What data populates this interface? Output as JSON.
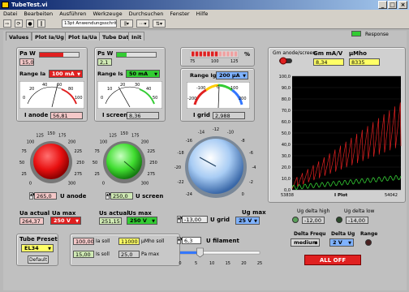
{
  "window": {
    "title": "TubeTest.vi"
  },
  "menu": [
    "Datei",
    "Bearbeiten",
    "Ausführen",
    "Werkzeuge",
    "Durchsuchen",
    "Fenster",
    "Hilfe"
  ],
  "toolbar": {
    "font": "13pt Anwendungsschriftart"
  },
  "tabs": [
    "Values",
    "Plot Ia/Ug",
    "Plot Ia/Ua",
    "Tube Data",
    "Init"
  ],
  "response_label": "Response",
  "pa": {
    "label": "Pa W",
    "value": "15,0",
    "range_label": "Range Ia",
    "range": "100 mA",
    "meter_ticks": [
      "0",
      "20",
      "40",
      "60",
      "80",
      "100"
    ],
    "caption": "I anode",
    "reading": "56,81",
    "level": 0.6
  },
  "ps": {
    "label": "Ps W",
    "value": "2,1",
    "range_label": "Range Is",
    "range": "50 mA",
    "meter_ticks": [
      "0",
      "10",
      "20",
      "30",
      "40",
      "50"
    ],
    "caption": "I screen",
    "reading": "8,36",
    "level": 0.25
  },
  "pct": {
    "unit": "%",
    "ticks": [
      "75",
      "100",
      "125"
    ]
  },
  "ig": {
    "range_label": "Range Ig",
    "range": "200 µA",
    "meter_ticks": [
      "-200",
      "-100",
      "0",
      "100",
      "200"
    ],
    "caption": "I grid",
    "reading": "2,988"
  },
  "knob_ua": {
    "ticks": [
      "0",
      "25",
      "50",
      "75",
      "100",
      "125",
      "150",
      "175",
      "200",
      "225",
      "250",
      "275",
      "300"
    ],
    "value": "265,0",
    "label": "U anode"
  },
  "knob_us": {
    "ticks": [
      "0",
      "25",
      "50",
      "75",
      "100",
      "125",
      "150",
      "175",
      "200",
      "225",
      "250",
      "275",
      "300"
    ],
    "value": "250,0",
    "label": "U screen"
  },
  "knob_ug": {
    "ticks": [
      "-24",
      "-22",
      "-20",
      "-18",
      "-16",
      "-14",
      "-12",
      "-10",
      "-8",
      "-6",
      "-4",
      "-2",
      "0"
    ],
    "value": "-13,00",
    "label": "U grid"
  },
  "ua_actual": {
    "label": "Ua actual",
    "value": "264,37"
  },
  "ua_max": {
    "label": "Ua max",
    "value": "250 V"
  },
  "us_actual": {
    "label": "Us actual",
    "value": "251,15"
  },
  "us_max": {
    "label": "Us max",
    "value": "250 V"
  },
  "ug_max": {
    "label": "Ug max",
    "value": "25 V"
  },
  "filament": {
    "value": "6,3",
    "label": "U filament",
    "ticks": [
      "0",
      "5",
      "10",
      "15",
      "20",
      "25"
    ],
    "level": 0.25
  },
  "preset": {
    "label": "Tube Preset",
    "value": "EL34",
    "default": "Default",
    "ia_soll": "100,00",
    "ia_soll_label": "Ia soll",
    "umho_soll": "11000",
    "umho_soll_label": "µMho soll",
    "is_soll": "15,00",
    "is_soll_label": "Is soll",
    "pa_max": "25,0",
    "pa_max_label": "Pa max"
  },
  "graph": {
    "toggle_label": "Gm anode/screen",
    "gm_label": "Gm mA/V",
    "gm": "8,34",
    "umho_label": "µMho",
    "umho": "8335",
    "x_start": "53838",
    "x_end": "54042",
    "x_label": "I Plot",
    "y_ticks": [
      "100,0",
      "90,0",
      "80,0",
      "70,0",
      "60,0",
      "50,0",
      "40,0",
      "30,0",
      "20,0",
      "10,0",
      "0,0"
    ]
  },
  "ug_delta_high": {
    "label": "Ug delta high",
    "value": "-12,00"
  },
  "ug_delta_low": {
    "label": "Ug delta low",
    "value": "-14,00"
  },
  "delta_frequ": {
    "label": "Delta Frequ",
    "value": "medium"
  },
  "delta_ug": {
    "label": "Delta Ug",
    "value": "2 V"
  },
  "range_led": {
    "label": "Range"
  },
  "all_off": "ALL OFF",
  "colors": {
    "red": "#e02020",
    "green": "#33cc33",
    "yellow": "#ffff66",
    "blue": "#7fb2ff"
  }
}
